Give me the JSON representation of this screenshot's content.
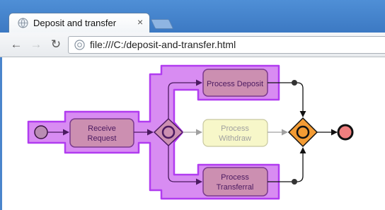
{
  "browser": {
    "tab_title": "Deposit and transfer",
    "tab_close": "×",
    "url": "file:///C:/deposit-and-transfer.html",
    "nav": {
      "back": "←",
      "forward": "→",
      "reload": "↻"
    }
  },
  "diagram": {
    "nodes": {
      "receive_request": {
        "line1": "Receive",
        "line2": "Request"
      },
      "process_deposit": {
        "line1": "Process Deposit"
      },
      "process_withdraw": {
        "line1": "Process",
        "line2": "Withdraw"
      },
      "process_transferral": {
        "line1": "Process",
        "line2": "Transferral"
      }
    },
    "colors": {
      "highlight_fill": "#d88cf2",
      "highlight_stroke": "#b13cf0",
      "task_fill": "#cc8fb1",
      "task_stroke": "#7b3a8d",
      "inactive_task_fill": "#f7f7c9",
      "inactive_task_stroke": "#c8c8a0",
      "inactive_text": "#a0a0a0",
      "gateway_end_fill": "#f39b34",
      "end_event_fill": "#f07f7f",
      "start_event_fill": "#b98cb3",
      "arrow_active": "#4b1a60",
      "arrow_inactive": "#a0a0a0"
    }
  }
}
